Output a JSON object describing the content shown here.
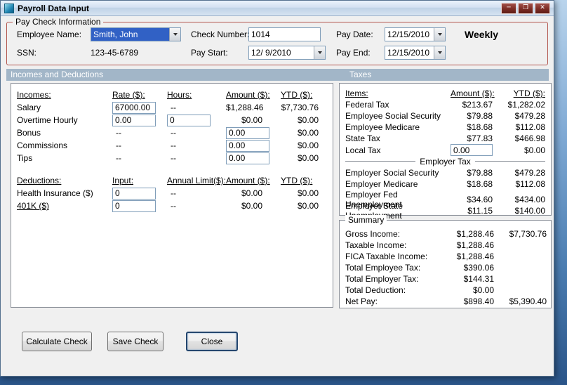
{
  "window": {
    "title": "Payroll Data Input",
    "minimize_glyph": "─",
    "maximize_glyph": "❐",
    "close_glyph": "✕"
  },
  "paycheck": {
    "group_label": "Pay Check Information",
    "employee_name": {
      "label": "Employee Name:",
      "value": "Smith, John"
    },
    "ssn": {
      "label": "SSN:",
      "value": "123-45-6789"
    },
    "check_number": {
      "label": "Check Number:",
      "value": "1014"
    },
    "pay_start": {
      "label": "Pay Start:",
      "value": "12/ 9/2010"
    },
    "pay_date": {
      "label": "Pay Date:",
      "value": "12/15/2010"
    },
    "pay_end": {
      "label": "Pay End:",
      "value": "12/15/2010"
    },
    "frequency": "Weekly"
  },
  "sections": {
    "left": "Incomes and Deductions",
    "right": "Taxes"
  },
  "incomes": {
    "headers": {
      "name": "Incomes:",
      "rate": "Rate ($):",
      "hours": "Hours:",
      "amount": "Amount ($):",
      "ytd": "YTD ($):"
    },
    "rows": [
      {
        "name": "Salary",
        "rate": "67000.00",
        "hours": "--",
        "amount": "$1,288.46",
        "ytd": "$7,730.76"
      },
      {
        "name": "Overtime Hourly",
        "rate": "0.00",
        "hours": "0",
        "amount": "$0.00",
        "ytd": "$0.00"
      },
      {
        "name": "Bonus",
        "rate": "--",
        "hours": "--",
        "amount": "0.00",
        "ytd": "$0.00"
      },
      {
        "name": "Commissions",
        "rate": "--",
        "hours": "--",
        "amount": "0.00",
        "ytd": "$0.00"
      },
      {
        "name": "Tips",
        "rate": "--",
        "hours": "--",
        "amount": "0.00",
        "ytd": "$0.00"
      }
    ]
  },
  "deductions": {
    "headers": {
      "name": "Deductions:",
      "input": "Input:",
      "limit": "Annual Limit($):",
      "amount": "Amount ($):",
      "ytd": "YTD ($):"
    },
    "rows": [
      {
        "name": "Health Insurance  ($)",
        "input": "0",
        "limit": "--",
        "amount": "$0.00",
        "ytd": "$0.00"
      },
      {
        "name": "401K  ($)",
        "input": "0",
        "limit": "--",
        "amount": "$0.00",
        "ytd": "$0.00"
      }
    ]
  },
  "taxes": {
    "headers": {
      "items": "Items:",
      "amount": "Amount ($):",
      "ytd": "YTD ($):"
    },
    "employee_rows": [
      {
        "name": "Federal Tax",
        "amount": "$213.67",
        "ytd": "$1,282.02"
      },
      {
        "name": "Employee Social Security",
        "amount": "$79.88",
        "ytd": "$479.28"
      },
      {
        "name": "Employee Medicare",
        "amount": "$18.68",
        "ytd": "$112.08"
      },
      {
        "name": "State Tax",
        "amount": "$77.83",
        "ytd": "$466.98"
      },
      {
        "name": "Local Tax",
        "amount": "0.00",
        "ytd": "$0.00"
      }
    ],
    "employer_label": "Employer Tax",
    "employer_rows": [
      {
        "name": "Employer Social Security",
        "amount": "$79.88",
        "ytd": "$479.28"
      },
      {
        "name": "Employer Medicare",
        "amount": "$18.68",
        "ytd": "$112.08"
      },
      {
        "name": "Employer Fed Unemployment",
        "amount": "$34.60",
        "ytd": "$434.00"
      },
      {
        "name": "Employer State Unemployment",
        "amount": "$11.15",
        "ytd": "$140.00"
      }
    ]
  },
  "summary": {
    "group_label": "Summary",
    "rows": [
      {
        "name": "Gross Income:",
        "amount": "$1,288.46",
        "ytd": "$7,730.76"
      },
      {
        "name": "Taxable Income:",
        "amount": "$1,288.46",
        "ytd": ""
      },
      {
        "name": "FICA Taxable Income:",
        "amount": "$1,288.46",
        "ytd": ""
      },
      {
        "name": "Total Employee Tax:",
        "amount": "$390.06",
        "ytd": ""
      },
      {
        "name": "Total Employer Tax:",
        "amount": "$144.31",
        "ytd": ""
      },
      {
        "name": "Total Deduction:",
        "amount": "$0.00",
        "ytd": ""
      },
      {
        "name": "Net Pay:",
        "amount": "$898.40",
        "ytd": "$5,390.40"
      }
    ]
  },
  "buttons": {
    "calculate": "Calculate Check",
    "save": "Save Check",
    "close": "Close"
  }
}
